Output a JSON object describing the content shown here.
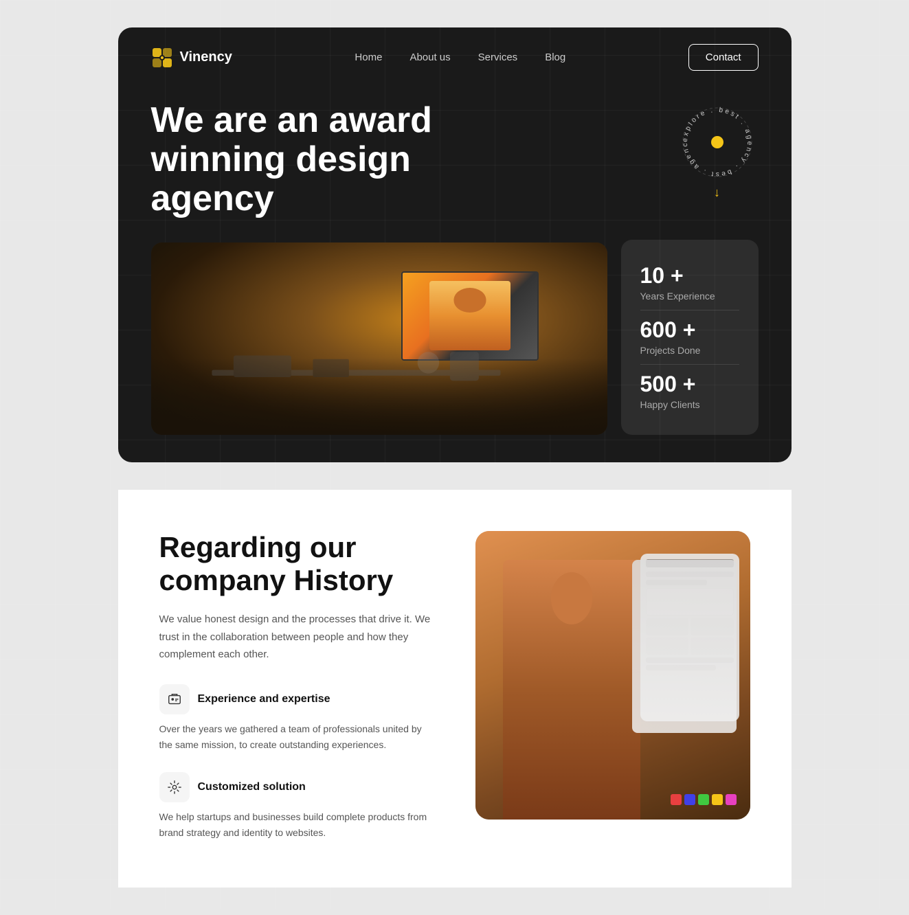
{
  "brand": {
    "name": "Vinency",
    "logo_icon": "⊕"
  },
  "nav": {
    "links": [
      {
        "label": "Home",
        "href": "#"
      },
      {
        "label": "About us",
        "href": "#"
      },
      {
        "label": "Services",
        "href": "#"
      },
      {
        "label": "Blog",
        "href": "#"
      }
    ],
    "cta_label": "Contact"
  },
  "hero": {
    "headline": "We are an award winning design agency",
    "badge_text": "explore . best . agency . best . agency .",
    "arrow": "↓"
  },
  "stats": [
    {
      "number": "10 +",
      "label": "Years Experience"
    },
    {
      "number": "600 +",
      "label": "Projects Done"
    },
    {
      "number": "500 +",
      "label": "Happy Clients"
    }
  ],
  "about": {
    "title": "Regarding our company History",
    "description": "We value honest design and the processes that drive it. We trust in the collaboration between people and how they complement each other.",
    "features": [
      {
        "icon": "🔧",
        "title": "Experience and expertise",
        "description": "Over the years we gathered a team of professionals united by the same mission, to create outstanding experiences."
      },
      {
        "icon": "⚙️",
        "title": "Customized solution",
        "description": "We help startups and businesses build complete products from brand strategy and identity to websites."
      }
    ]
  }
}
